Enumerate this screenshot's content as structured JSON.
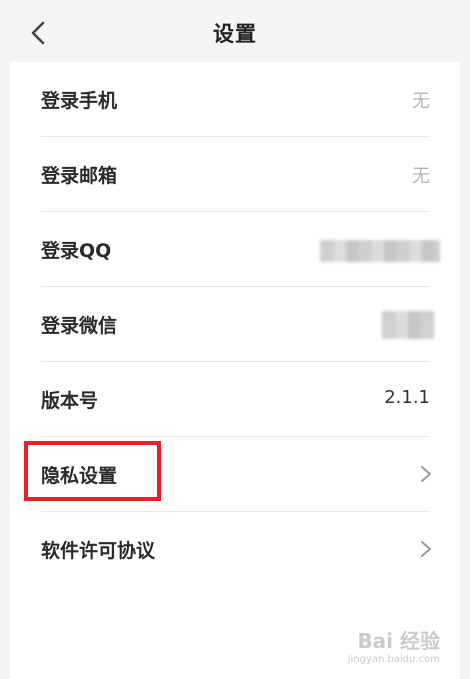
{
  "header": {
    "title": "设置"
  },
  "settings": {
    "items": [
      {
        "label": "登录手机",
        "value": "无"
      },
      {
        "label": "登录邮箱",
        "value": "无"
      },
      {
        "label": "登录QQ",
        "value": ""
      },
      {
        "label": "登录微信",
        "value": ""
      },
      {
        "label": "版本号",
        "value": "2.1.1"
      },
      {
        "label": "隐私设置",
        "value": ""
      },
      {
        "label": "软件许可协议",
        "value": ""
      }
    ]
  },
  "icons": {
    "back": "chevron-left-icon",
    "arrow": "chevron-right-icon"
  },
  "colors": {
    "highlight": "#e8202a",
    "muted_value": "#b5b5b5"
  },
  "watermark": {
    "brand": "Bai 经验",
    "url": "jingyan.baidu.com"
  }
}
